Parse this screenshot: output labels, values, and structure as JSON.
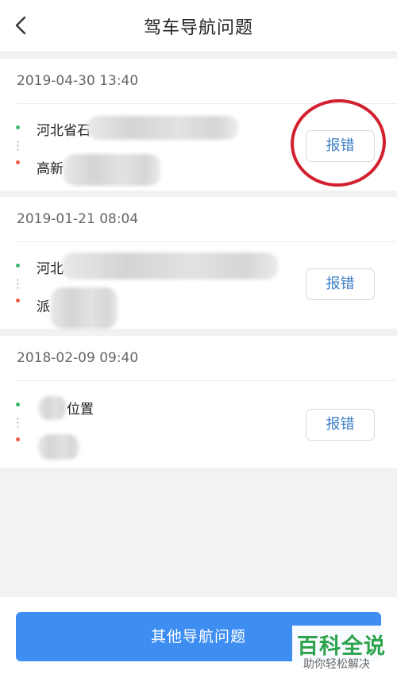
{
  "header": {
    "title": "驾车导航问题",
    "back_icon": "chevron-left-icon"
  },
  "records": [
    {
      "time": "2019-04-30 13:40",
      "from": "河北省石",
      "to": "高新",
      "report_label": "报错"
    },
    {
      "time": "2019-01-21 08:04",
      "from": "河北",
      "to": "派",
      "report_label": "报错"
    },
    {
      "time": "2018-02-09 09:40",
      "from": "位置",
      "to": "",
      "report_label": "报错"
    }
  ],
  "footer": {
    "other_button_label": "其他导航问题"
  },
  "watermark": {
    "title": "百科全说",
    "subtitle": "助你轻松解决"
  },
  "colors": {
    "accent_blue": "#3e8ef2",
    "link_blue": "#3d7fc4",
    "start_dot": "#3cba6c",
    "end_dot": "#ef5b4a",
    "annotation_red": "#d3202e",
    "watermark_green": "#2ca24a"
  }
}
